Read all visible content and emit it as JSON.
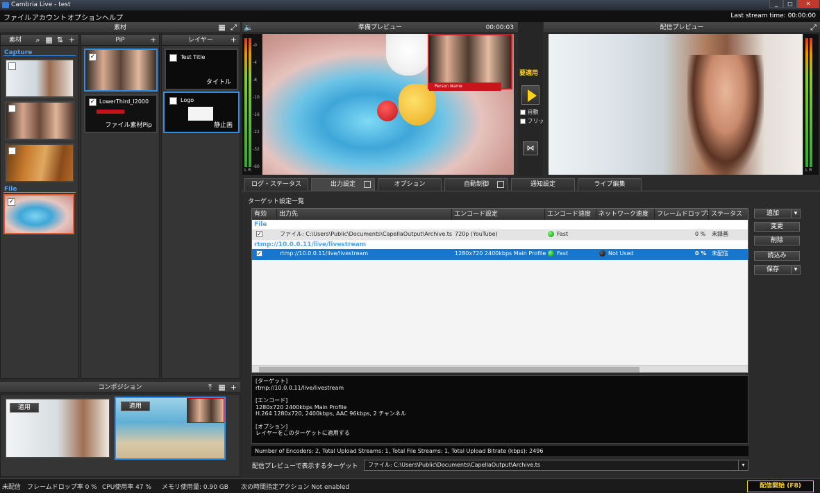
{
  "window": {
    "title": "Cambria Live - test",
    "min": "_",
    "max": "□",
    "close": "✕"
  },
  "menu": [
    "ファイル",
    "アカウント",
    "オプション",
    "ヘルプ"
  ],
  "last_stream": "Last stream time: 00:00:00",
  "materials": {
    "header": "素材",
    "tab_label": "素材",
    "capture_label": "Capture",
    "file_label": "File"
  },
  "pip": {
    "header": "PiP",
    "item2_label": "LowerThird_I2000",
    "item2_caption": "ファイル素材Pip"
  },
  "layers": {
    "header": "レイヤー",
    "item1_label": "Test Title",
    "item1_caption": "タイトル",
    "item2_label": "Logo",
    "item2_caption": "静止画"
  },
  "composition": {
    "header": "コンポジション",
    "apply1": "適用",
    "apply2": "適用"
  },
  "preview": {
    "header": "準備プレビュー",
    "time": "00:00:03",
    "lowerthird": "Person Name"
  },
  "transition": {
    "apply": "要適用",
    "auto": "自動",
    "freeze": "フリッ"
  },
  "program": {
    "header": "配信プレビュー"
  },
  "meter_ticks": [
    "-0",
    "-4",
    "-8",
    "-10",
    "-16",
    "-22",
    "-32",
    "-60"
  ],
  "meter_lr": "L R",
  "tabs": [
    "ログ・ステータス",
    "出力設定",
    "オプション",
    "自動制御",
    "通知設定",
    "ライブ編集"
  ],
  "targets": {
    "title": "ターゲット設定一覧",
    "columns": [
      "有効",
      "出力先",
      "エンコード設定",
      "エンコード速度",
      "ネットワーク速度",
      "フレームドロップ率",
      "ステータス"
    ],
    "group1": "File",
    "row1": {
      "dest": "ファイル: C:\\Users\\Public\\Documents\\CapellaOutput\\Archive.ts",
      "encode": "720p (YouTube)",
      "speed": "Fast",
      "net": "",
      "drop": "0 %",
      "status": "未録画"
    },
    "group2": "rtmp://10.0.0.11/live/livestream",
    "row2": {
      "dest": "rtmp://10.0.0.11/live/livestream",
      "encode": "1280x720 2400kbps Main Profile",
      "speed": "Fast",
      "net": "Not Used",
      "drop": "0 %",
      "status": "未配信"
    }
  },
  "buttons": {
    "add": "追加",
    "change": "変更",
    "delete": "削除",
    "load": "読込み",
    "save": "保存"
  },
  "details": {
    "l1": "[ターゲット]",
    "l2": "rtmp://10.0.0.11/live/livestream",
    "l3": "[エンコード]",
    "l4": "1280x720 2400kbps Main Profile",
    "l5": "H.264 1280x720, 2400kbps, AAC 96kbps, 2 チャンネル",
    "l6": "[オプション]",
    "l7": "レイヤーをこのターゲットに適用する"
  },
  "summary": "Number of Encoders: 2, Total Upload Streams: 1, Total File Streams: 1, Total Upload Bitrate (kbps): 2496",
  "preview_target": {
    "label": "配信プレビューで表示するターゲット",
    "value": "ファイル: C:\\Users\\Public\\Documents\\CapellaOutput\\Archive.ts"
  },
  "statusbar": {
    "state": "未配信",
    "drop": "フレームドロップ率 0 %",
    "cpu": "CPU使用率 47 %",
    "mem": "メモリ使用量: 0.90 GB",
    "next": "次の時間指定アクション Not enabled",
    "start": "配信開始 (F8)"
  }
}
